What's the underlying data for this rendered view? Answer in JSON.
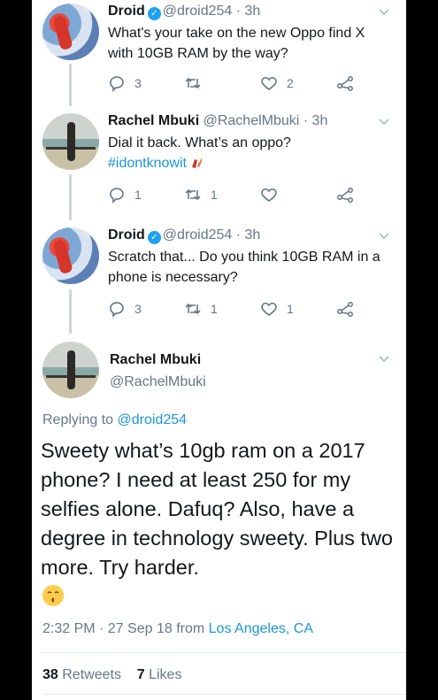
{
  "tweets": [
    {
      "name": "Droid",
      "verified": true,
      "handle": "@droid254",
      "time": "3h",
      "text": "What's your take on the new Oppo find X with 10GB RAM by the way?",
      "replies": "3",
      "retweets": "",
      "likes": "2"
    },
    {
      "name": "Rachel Mbuki",
      "handle": "@RachelMbuki",
      "time": "3h",
      "text": "Dial it back. What’s an oppo?",
      "hashtag": "#idontknowit",
      "replies": "1",
      "retweets": "1",
      "likes": ""
    },
    {
      "name": "Droid",
      "verified": true,
      "handle": "@droid254",
      "time": "3h",
      "text": "Scratch that... Do you think 10GB RAM in a phone is necessary?",
      "replies": "3",
      "retweets": "1",
      "likes": "1"
    }
  ],
  "main": {
    "name": "Rachel Mbuki",
    "handle": "@RachelMbuki",
    "replying_label": "Replying to",
    "replying_to": "@droid254",
    "text": "Sweety what’s 10gb ram on a 2017 phone? I need at least 250 for my selfies alone. Dafuq? Also, have a degree in technology sweety. Plus two more. Try harder.",
    "timestamp": "2:32 PM · 27 Sep 18 from",
    "location": "Los Angeles, CA",
    "retweet_count": "38",
    "retweet_label": "Retweets",
    "like_count": "7",
    "like_label": "Likes"
  },
  "colors": {
    "link": "#1b95e0",
    "secondary": "#657786",
    "verified": "#1da1f2"
  }
}
